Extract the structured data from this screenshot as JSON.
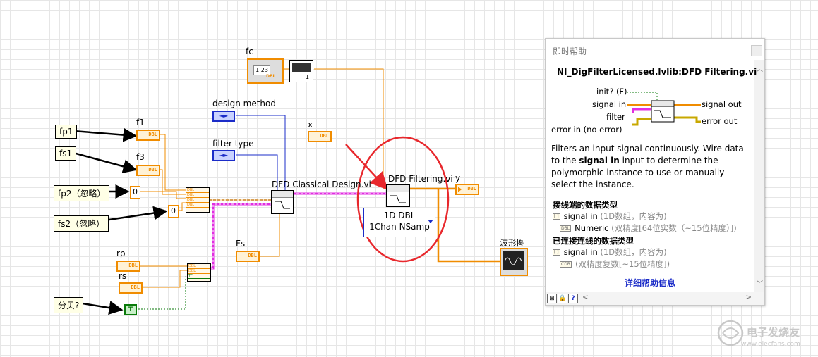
{
  "inputs": {
    "fp1": "fp1",
    "fs1": "fs1",
    "fp2": "fp2（忽略）",
    "fs2": "fs2（忽略）",
    "db": "分贝?"
  },
  "labels": {
    "fc": "fc",
    "f1": "f1",
    "f3": "f3",
    "design_method": "design method",
    "filter_type": "filter type",
    "x": "x",
    "y": "y",
    "fs_cap": "Fs",
    "rp": "rp",
    "rs": "rs",
    "classical": "DFD Classical Design.vi",
    "filtering": "DFD Filtering.vi",
    "waveform": "波形图"
  },
  "terminals": {
    "dbl": "DBL",
    "numeric": "1.23",
    "zero_a": "0",
    "zero_b": "0",
    "bool_true": "T",
    "tf": "TF",
    "one": "1"
  },
  "poly": {
    "line1": "1D DBL",
    "line2": "1Chan NSamp"
  },
  "help_panel": {
    "title": "即时帮助",
    "vi_name": "NI_DigFilterLicensed.lvlib:DFD Filtering.vi",
    "terminals": {
      "init": "init? (F)",
      "signal_in": "signal in",
      "filter": "filter",
      "error_in": "error in (no error)",
      "signal_out": "signal out",
      "error_out": "error out"
    },
    "desc_1": "Filters an input signal continuously. Wire data to the ",
    "desc_bold": "signal in",
    "desc_2": " input to determine the polymorphic instance to use or manually select the instance.",
    "section1": "接线端的数据类型",
    "s1_item1_name": "signal in",
    "s1_item1_note": "(1D数组，内容为)",
    "s1_item2_name": "Numeric",
    "s1_item2_note": "(双精度[64位实数（~15位精度）])",
    "section2": "已连接连线的数据类型",
    "s2_item1_name": "signal in",
    "s2_item1_note": "(1D数组，内容为)",
    "s2_item2_note": "(双精度复数[~15位精度])",
    "link": "详细帮助信息"
  },
  "watermark": {
    "brand": "电子发烧友",
    "url": "www.elecfans.com"
  },
  "colors": {
    "orange_wire": "#f08c00",
    "blue_wire": "#1b2cc8",
    "pink_wire": "#e12ee1",
    "green_wire": "#0a7a0a",
    "annotation_red": "#e8282d"
  }
}
